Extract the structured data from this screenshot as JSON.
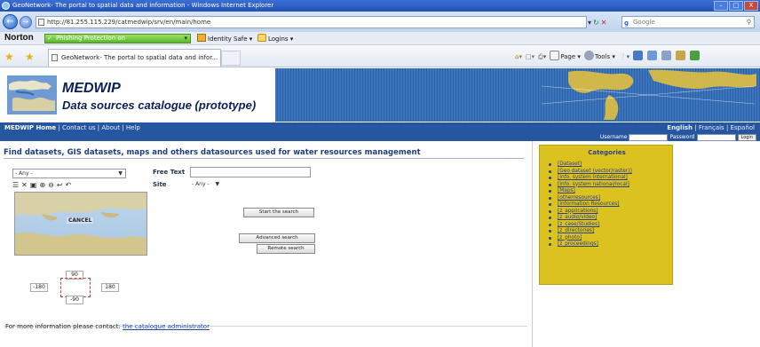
{
  "window": {
    "title": "GeoNetwork- The portal to spatial data and information - Windows Internet Explorer",
    "min": "–",
    "max": "□",
    "close": "X"
  },
  "address": {
    "url": "http://81.255.115.229/catmedwip/srv/en/main/home",
    "search_placeholder": "Google"
  },
  "norton": {
    "logo": "Norton",
    "status": "Phishing Protection on",
    "identity_safe": "Identity Safe ▾",
    "logins": "Logins ▾"
  },
  "tabs": {
    "active_title": "GeoNetwork- The portal to spatial data and infor...",
    "page_menu": "Page ▾",
    "tools_menu": "Tools ▾"
  },
  "banner": {
    "title": "MEDWIP",
    "subtitle": "Data sources catalogue (prototype)"
  },
  "nav": {
    "home": "MEDWIP Home",
    "contact": "Contact us",
    "about": "About",
    "help": "Help",
    "lang_en": "English",
    "lang_fr": "Français",
    "lang_es": "Español"
  },
  "login": {
    "username_label": "Username",
    "password_label": "Password",
    "button": "Login"
  },
  "search": {
    "headline": "Find datasets, GIS datasets, maps and others datasources used for water resources management",
    "group_value": "- Any -",
    "free_text_label": "Free Text",
    "site_label": "Site",
    "site_value": "- Any -",
    "map_cancel": "CANCEL",
    "start_button": "Start the search",
    "advanced_button": "Advanced search",
    "remote_button": "Remote search",
    "bbox_north": "90",
    "bbox_west": "-180",
    "bbox_east": "180",
    "bbox_south": "-90"
  },
  "footer": {
    "contact_text": "For more information please contact: ",
    "contact_link": "the catalogue administrator"
  },
  "categories": {
    "title": "Categories",
    "items": [
      "[Dataset]",
      "[Geo dataset (vector/raster)]",
      "[Info. system international]",
      "[Info. system national/local]",
      "[Maps]",
      "[otherresources]",
      "[Information Resources]",
      "[z_applications]",
      "[z_audio/video]",
      "[z_case/Studies]",
      "[z_directories]",
      "[z_photo]",
      "[z_proceedings]"
    ]
  },
  "colors": {
    "nav_bar": "#2756a0",
    "banner_blue": "#3d75bd",
    "categories_bg": "#dcc21e",
    "headline": "#1e3f7e",
    "norton_green": "#58b82a"
  }
}
